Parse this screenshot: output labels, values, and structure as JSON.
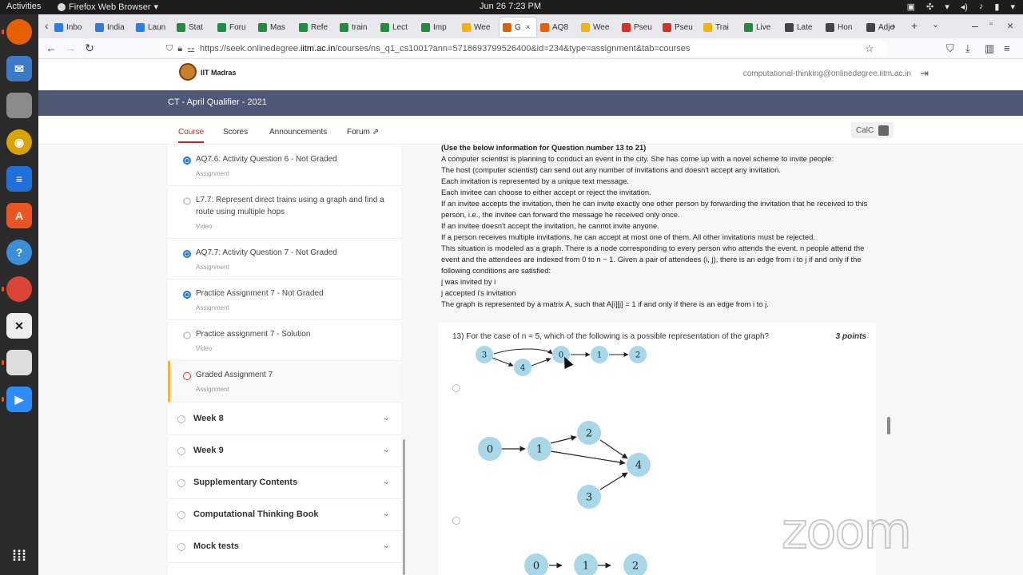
{
  "system": {
    "activities": "Activities",
    "app_name": "Firefox Web Browser",
    "clock": "Jun 26  7:23 PM"
  },
  "browser": {
    "tabs": [
      "Inbo",
      "India",
      "Laun",
      "Stat",
      "Foru",
      "Mas",
      "Refe",
      "train",
      "Lect",
      "Imp",
      "Wee",
      "G",
      "AQ8",
      "Wee",
      "Pseu",
      "Pseu",
      "Trai",
      "Live",
      "Late",
      "Hon",
      "Adje"
    ],
    "url_prefix": "https://seek.onlinedegree.",
    "url_host": "iitm.ac.in",
    "url_rest": "/courses/ns_q1_cs1001?ann=5718693799526400&id=234&type=assignment&tab=courses"
  },
  "site": {
    "logo_text": "IIT Madras",
    "user_email": "computational-thinking@onlinedegree.iitm.ac.in",
    "course_title": "CT - April Qualifier - 2021",
    "tabs": [
      "Course",
      "Scores",
      "Announcements",
      "Forum"
    ],
    "calc_label": "CalC"
  },
  "sidebar": {
    "items": [
      {
        "title": "AQ7.6: Activity Question 6 - Not Graded",
        "sub": "Assignment"
      },
      {
        "title": "L7.7: Represent direct trains using a graph and find a route using multiple hops",
        "sub": "Video"
      },
      {
        "title": "AQ7.7: Activity Question 7 - Not Graded",
        "sub": "Assignment"
      },
      {
        "title": "Practice Assignment 7 - Not Graded",
        "sub": "Assignment"
      },
      {
        "title": "Practice assignment 7 - Solution",
        "sub": "Video"
      },
      {
        "title": "Graded Assignment 7",
        "sub": "Assignment"
      }
    ],
    "weeks": [
      "Week 8",
      "Week 9",
      "Supplementary Contents",
      "Computational Thinking Book",
      "Mock tests"
    ]
  },
  "main": {
    "info_heading": "(Use the below information for Question number 13 to 21)",
    "info_lines": [
      "A computer scientist is planning to conduct an event in the city. She has come up with a novel scheme to invite people:",
      "The host (computer scientist) can send out any number of invitations and doesn't accept any invitation.",
      "Each invitation is represented by a unique text message.",
      "Each invitee can choose to either accept or reject the invitation.",
      "If an invitee accepts the invitation, then he can invite exactly one other person by forwarding the invitation that he received to this",
      "person, i.e., the invitee can forward the message he received only once.",
      "If an invitee doesn't accept the invitation, he cannot invite anyone.",
      "If a person receives multiple invitations, he can accept at most one of them. All other invitations must be rejected.",
      "This situation is modeled as a graph. There is a node corresponding to every person who attends the event. n people attend the",
      "event and the attendees are indexed from 0 to n − 1. Given a pair of attendees (i, j), there is an edge from i to j if and only if the",
      "following conditions are satisfied:",
      "j was invited by i",
      "j accepted i's invitation",
      "The graph is represented by a matrix A, such that A[i][j] = 1 if and only if there is an edge from i to j."
    ],
    "question": "13) For the case of n = 5, which of the following is a possible representation of the graph?",
    "points": "3 points",
    "graph1_nodes": [
      "3",
      "4",
      "0",
      "1",
      "2"
    ],
    "graph2_nodes": [
      "0",
      "1",
      "2",
      "4",
      "3"
    ],
    "graph3_nodes": [
      "0",
      "1",
      "2"
    ]
  },
  "overlay": {
    "watermark": "zoom"
  },
  "colors": {
    "course_bar": "#4f5877",
    "accent_red": "#b3302b",
    "radio_blue": "#1a73e8",
    "node_fill": "#a8d8e8"
  }
}
